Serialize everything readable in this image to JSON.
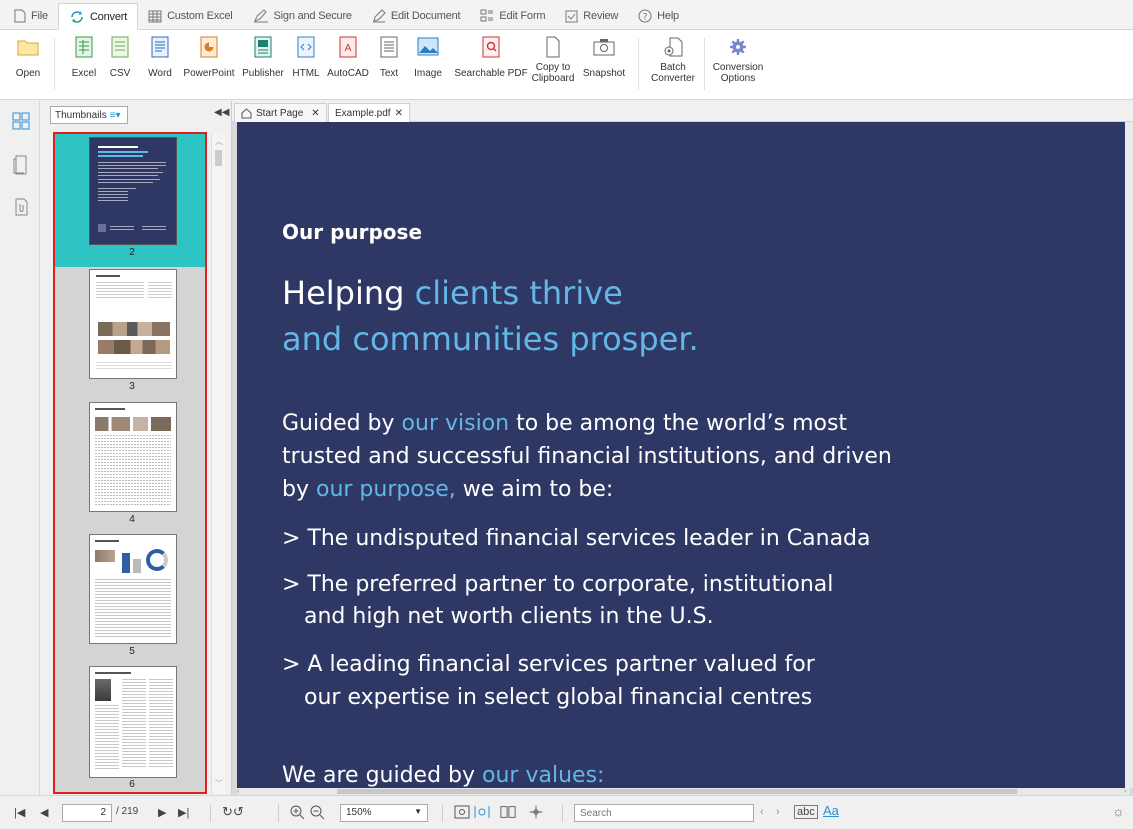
{
  "menu": {
    "tabs": [
      {
        "label": "File",
        "icon": "file-icon"
      },
      {
        "label": "Convert",
        "icon": "convert-icon",
        "active": true
      },
      {
        "label": "Custom Excel",
        "icon": "table-icon"
      },
      {
        "label": "Sign and Secure",
        "icon": "pen-icon"
      },
      {
        "label": "Edit Document",
        "icon": "edit-icon"
      },
      {
        "label": "Edit Form",
        "icon": "form-icon"
      },
      {
        "label": "Review",
        "icon": "review-icon"
      },
      {
        "label": "Help",
        "icon": "help-icon"
      }
    ]
  },
  "ribbon": {
    "open": "Open",
    "excel": "Excel",
    "csv": "CSV",
    "word": "Word",
    "powerpoint": "PowerPoint",
    "publisher": "Publisher",
    "html": "HTML",
    "autocad": "AutoCAD",
    "text": "Text",
    "image": "Image",
    "searchable_pdf": "Searchable PDF",
    "copy_clipboard": "Copy to\nClipboard",
    "snapshot": "Snapshot",
    "batch": "Batch\nConverter",
    "conversion_options": "Conversion\nOptions"
  },
  "sidebar": {
    "dropdown": "Thumbnails",
    "thumbs": [
      {
        "num": "2",
        "selected": true
      },
      {
        "num": "3"
      },
      {
        "num": "4"
      },
      {
        "num": "5"
      },
      {
        "num": "6"
      }
    ]
  },
  "doctabs": {
    "start": "Start Page",
    "example": "Example.pdf"
  },
  "page": {
    "heading": "Our purpose",
    "title1_a": "Helping ",
    "title1_b": "clients thrive",
    "title2": "and communities prosper.",
    "p1_a": "Guided by ",
    "p1_b": "our vision",
    "p1_c": " to be among the world’s most",
    "p2": "trusted and successful financial institutions, and driven",
    "p3_a": "by ",
    "p3_b": "our purpose,",
    "p3_c": " we aim to be:",
    "b1": "> The undisputed financial services leader in Canada",
    "b2a": "> The preferred partner to corporate, institutional",
    "b2b": "and high net worth clients in the U.S.",
    "b3a": "> A leading financial services partner valued for",
    "b3b": "our expertise in select global financial centres",
    "last_a": "We are guided by ",
    "last_b": "our values:"
  },
  "status": {
    "page_current": "2",
    "page_total": "/ 219",
    "zoom": "150%",
    "search_placeholder": "Search"
  },
  "colors": {
    "page_bg": "#2f3864",
    "highlight": "#63b7e6",
    "selection": "#2ec4c4",
    "outline": "#e02020"
  }
}
